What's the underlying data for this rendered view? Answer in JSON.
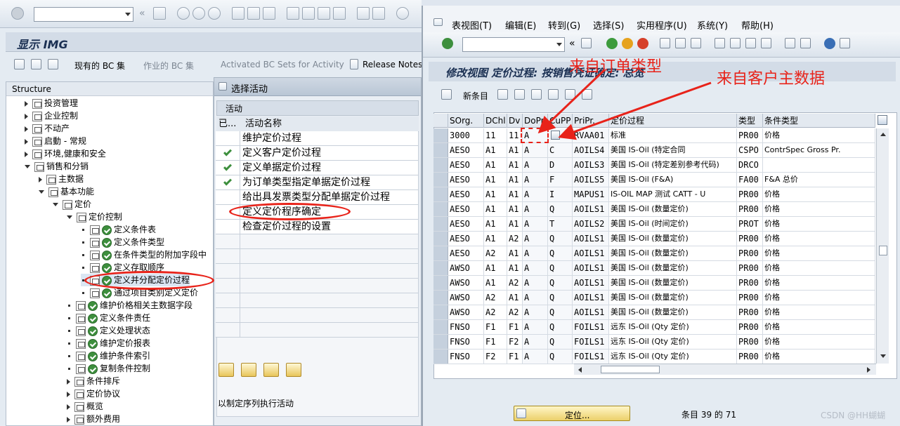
{
  "left_window": {
    "toolbar_history_arrow": "«",
    "title": "显示 IMG",
    "app_toolbar": {
      "existing_bc_sets": "现有的 BC 集",
      "work_bc_sets": "作业的 BC 集",
      "activated_bc_sets": "Activated BC Sets for Activity",
      "release_notes": "Release Notes"
    },
    "structure_header": "Structure",
    "tree": [
      {
        "label": "投资管理",
        "level": 1,
        "kind": "folder",
        "expander": "right"
      },
      {
        "label": "企业控制",
        "level": 1,
        "kind": "folder",
        "expander": "right"
      },
      {
        "label": "不动产",
        "level": 1,
        "kind": "folder",
        "expander": "right"
      },
      {
        "label": "启動 - 常规",
        "level": 1,
        "kind": "folder",
        "expander": "right"
      },
      {
        "label": "环境,健康和安全",
        "level": 1,
        "kind": "folder",
        "expander": "right"
      },
      {
        "label": "销售和分销",
        "level": 1,
        "kind": "folder",
        "expander": "down"
      },
      {
        "label": "主数据",
        "level": 2,
        "kind": "folder",
        "expander": "right"
      },
      {
        "label": "基本功能",
        "level": 2,
        "kind": "folder",
        "expander": "down"
      },
      {
        "label": "定价",
        "level": 3,
        "kind": "folder",
        "expander": "down"
      },
      {
        "label": "定价控制",
        "level": 4,
        "kind": "folder",
        "expander": "down"
      },
      {
        "label": "定义条件表",
        "level": 5,
        "kind": "activity",
        "expander": "dot"
      },
      {
        "label": "定义条件类型",
        "level": 5,
        "kind": "activity",
        "expander": "dot"
      },
      {
        "label": "在条件类型的附加字段中",
        "level": 5,
        "kind": "activity",
        "expander": "dot"
      },
      {
        "label": "定义存取顺序",
        "level": 5,
        "kind": "activity",
        "expander": "dot"
      },
      {
        "label": "定义并分配定价过程",
        "level": 5,
        "kind": "activity",
        "expander": "dot"
      },
      {
        "label": "通过项目类别定义定价",
        "level": 5,
        "kind": "activity",
        "expander": "dot"
      },
      {
        "label": "维护价格相关主数据字段",
        "level": 4,
        "kind": "activity",
        "expander": "dot"
      },
      {
        "label": "定义条件责任",
        "level": 4,
        "kind": "activity",
        "expander": "dot"
      },
      {
        "label": "定义处理状态",
        "level": 4,
        "kind": "activity",
        "expander": "dot"
      },
      {
        "label": "维护定价报表",
        "level": 4,
        "kind": "activity",
        "expander": "dot"
      },
      {
        "label": "维护条件索引",
        "level": 4,
        "kind": "activity",
        "expander": "dot"
      },
      {
        "label": "复制条件控制",
        "level": 4,
        "kind": "activity",
        "expander": "dot"
      },
      {
        "label": "条件排斥",
        "level": 4,
        "kind": "folder",
        "expander": "right"
      },
      {
        "label": "定价协议",
        "level": 4,
        "kind": "folder",
        "expander": "right"
      },
      {
        "label": "概览",
        "level": 4,
        "kind": "folder",
        "expander": "right"
      },
      {
        "label": "额外费用",
        "level": 4,
        "kind": "folder",
        "expander": "right"
      }
    ]
  },
  "activity_dialog": {
    "title": "选择活动",
    "section_label": "活动",
    "col_done": "已...",
    "col_name": "活动名称",
    "rows": [
      {
        "done": false,
        "name": "维护定价过程"
      },
      {
        "done": true,
        "name": "定义客户定价过程"
      },
      {
        "done": true,
        "name": "定义单据定价过程"
      },
      {
        "done": true,
        "name": "为订单类型指定单据定价过程"
      },
      {
        "done": false,
        "name": "给出具发票类型分配单据定价过程"
      },
      {
        "done": false,
        "name": "定义定价程序确定"
      },
      {
        "done": false,
        "name": "检查定价过程的设置"
      }
    ],
    "hint": "以制定序列执行活动"
  },
  "right_window": {
    "menu": [
      {
        "label": "表视图(T)"
      },
      {
        "label": "编辑(E)"
      },
      {
        "label": "转到(G)"
      },
      {
        "label": "选择(S)"
      },
      {
        "label": "实用程序(U)"
      },
      {
        "label": "系统(Y)"
      },
      {
        "label": "帮助(H)"
      }
    ],
    "toolbar_history_arrow": "«",
    "title": "修改视图 定价过程: 按销售凭证确定: 总览",
    "new_entries": "新条目",
    "annotation_order_type": "来自订单类型",
    "annotation_customer": "来自客户主数据",
    "columns": [
      "SOrg.",
      "DChl",
      "Dv",
      "DoPr",
      "CuPP",
      "PriPr.",
      "定价过程",
      "类型",
      "条件类型"
    ],
    "rows": [
      [
        "3000",
        "11",
        "11",
        "A",
        "",
        "RVAA01",
        "标准",
        "PR00",
        "价格"
      ],
      [
        "AESO",
        "A1",
        "A1",
        "A",
        "C",
        "AOILS4",
        "美国 IS-Oil (特定合同",
        "CSPO",
        "ContrSpec Gross Pr."
      ],
      [
        "AESO",
        "A1",
        "A1",
        "A",
        "D",
        "AOILS3",
        "美国 IS-Oil (特定差别参考代码)",
        "DRCO",
        ""
      ],
      [
        "AESO",
        "A1",
        "A1",
        "A",
        "F",
        "AOILS5",
        "美国 IS-Oil (F&A)",
        "FA00",
        "F&A 总价"
      ],
      [
        "AESO",
        "A1",
        "A1",
        "A",
        "I",
        "MAPUS1",
        "IS-OIL MAP 测试 CATT - U",
        "PR00",
        "价格"
      ],
      [
        "AESO",
        "A1",
        "A1",
        "A",
        "Q",
        "AOILS1",
        "美国 IS-Oil (数量定价)",
        "PR00",
        "价格"
      ],
      [
        "AESO",
        "A1",
        "A1",
        "A",
        "T",
        "AOILS2",
        "美国 IS-Oil (时间定价)",
        "PROT",
        "价格"
      ],
      [
        "AESO",
        "A1",
        "A2",
        "A",
        "Q",
        "AOILS1",
        "美国 IS-Oil (数量定价)",
        "PR00",
        "价格"
      ],
      [
        "AESO",
        "A2",
        "A1",
        "A",
        "Q",
        "AOILS1",
        "美国 IS-Oil (数量定价)",
        "PR00",
        "价格"
      ],
      [
        "AWSO",
        "A1",
        "A1",
        "A",
        "Q",
        "AOILS1",
        "美国 IS-Oil (数量定价)",
        "PR00",
        "价格"
      ],
      [
        "AWSO",
        "A1",
        "A2",
        "A",
        "Q",
        "AOILS1",
        "美国 IS-Oil (数量定价)",
        "PR00",
        "价格"
      ],
      [
        "AWSO",
        "A2",
        "A1",
        "A",
        "Q",
        "AOILS1",
        "美国 IS-Oil (数量定价)",
        "PR00",
        "价格"
      ],
      [
        "AWSO",
        "A2",
        "A2",
        "A",
        "Q",
        "AOILS1",
        "美国 IS-Oil (数量定价)",
        "PR00",
        "价格"
      ],
      [
        "FNSO",
        "F1",
        "F1",
        "A",
        "Q",
        "FOILS1",
        "远东 IS-Oil (Qty 定价)",
        "PR00",
        "价格"
      ],
      [
        "FNSO",
        "F1",
        "F2",
        "A",
        "Q",
        "FOILS1",
        "远东 IS-Oil (Qty 定价)",
        "PR00",
        "价格"
      ],
      [
        "FNSO",
        "F2",
        "F1",
        "A",
        "Q",
        "FOILS1",
        "远东 IS-Oil (Qty 定价)",
        "PR00",
        "价格"
      ]
    ],
    "position_button": "定位...",
    "entry_count": "条目 39 的 71"
  },
  "watermark": "CSDN @HH蝴蝴",
  "colors": {
    "annotation_red": "#e8231a",
    "bg": "#dfe6ef",
    "title_bg": "#d4dce7"
  }
}
